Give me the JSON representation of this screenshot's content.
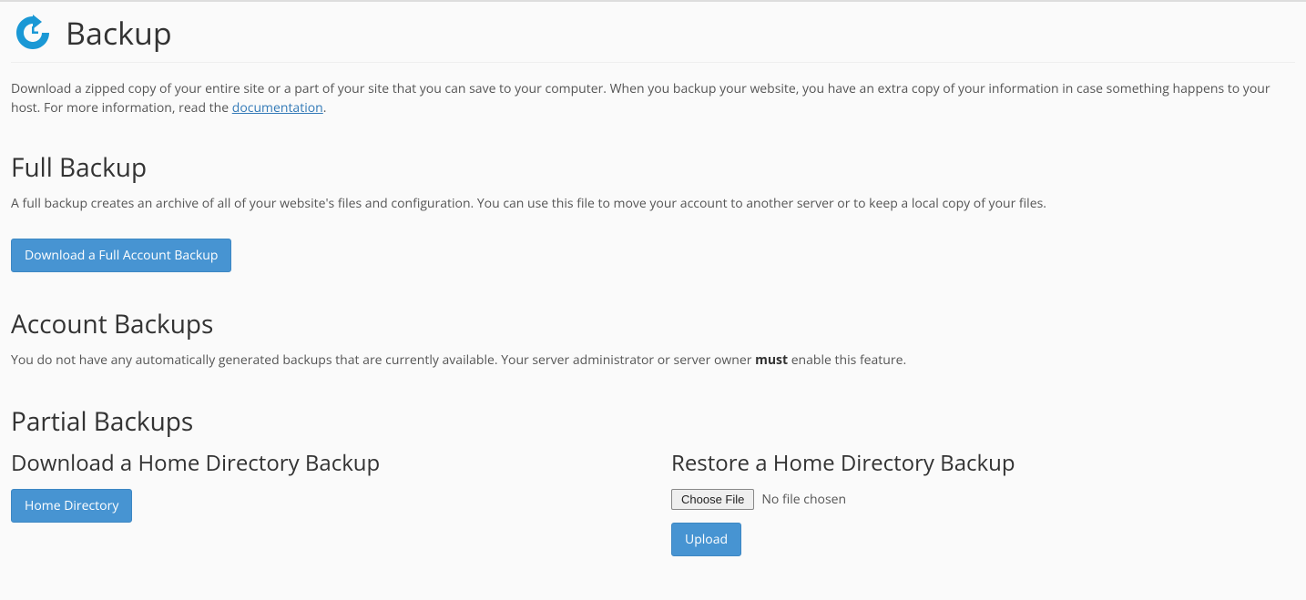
{
  "page": {
    "title": "Backup",
    "intro_part1": "Download a zipped copy of your entire site or a part of your site that you can save to your computer. When you backup your website, you have an extra copy of your information in case something happens to your host. For more information, read the ",
    "intro_link": "documentation",
    "intro_part2": "."
  },
  "full_backup": {
    "heading": "Full Backup",
    "desc": "A full backup creates an archive of all of your website's files and configuration. You can use this file to move your account to another server or to keep a local copy of your files.",
    "button": "Download a Full Account Backup"
  },
  "account_backups": {
    "heading": "Account Backups",
    "desc_part1": "You do not have any automatically generated backups that are currently available. Your server administrator or server owner ",
    "desc_strong": "must",
    "desc_part2": " enable this feature."
  },
  "partial_backups": {
    "heading": "Partial Backups",
    "download": {
      "heading": "Download a Home Directory Backup",
      "button": "Home Directory"
    },
    "restore": {
      "heading": "Restore a Home Directory Backup",
      "choose_file": "Choose File",
      "file_status": "No file chosen",
      "upload_button": "Upload"
    }
  }
}
